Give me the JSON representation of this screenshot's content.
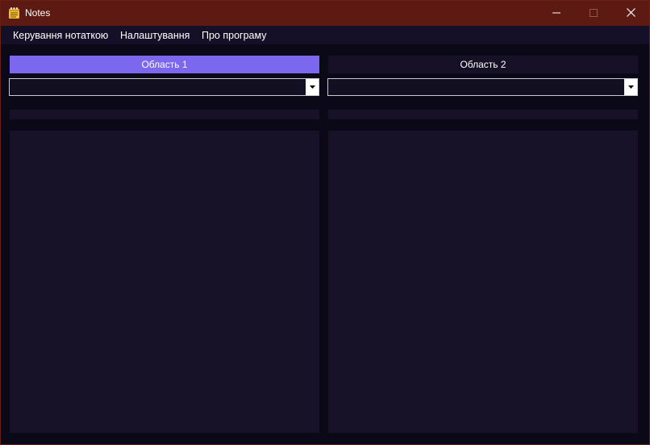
{
  "window": {
    "title": "Notes",
    "icon": "notes-app-icon",
    "controls": [
      "minimize-icon",
      "maximize-icon",
      "close-icon"
    ]
  },
  "menu": {
    "items": [
      {
        "label": "Керування нотаткою"
      },
      {
        "label": "Налаштування"
      },
      {
        "label": "Про програму"
      }
    ]
  },
  "areas": [
    {
      "label": "Область 1",
      "selected_value": "",
      "active": true
    },
    {
      "label": "Область 2",
      "selected_value": "",
      "active": false
    }
  ],
  "colors": {
    "titlebar": "#5c1a12",
    "accent": "#7b68ee",
    "background": "#0b0818",
    "panel": "#181229"
  }
}
